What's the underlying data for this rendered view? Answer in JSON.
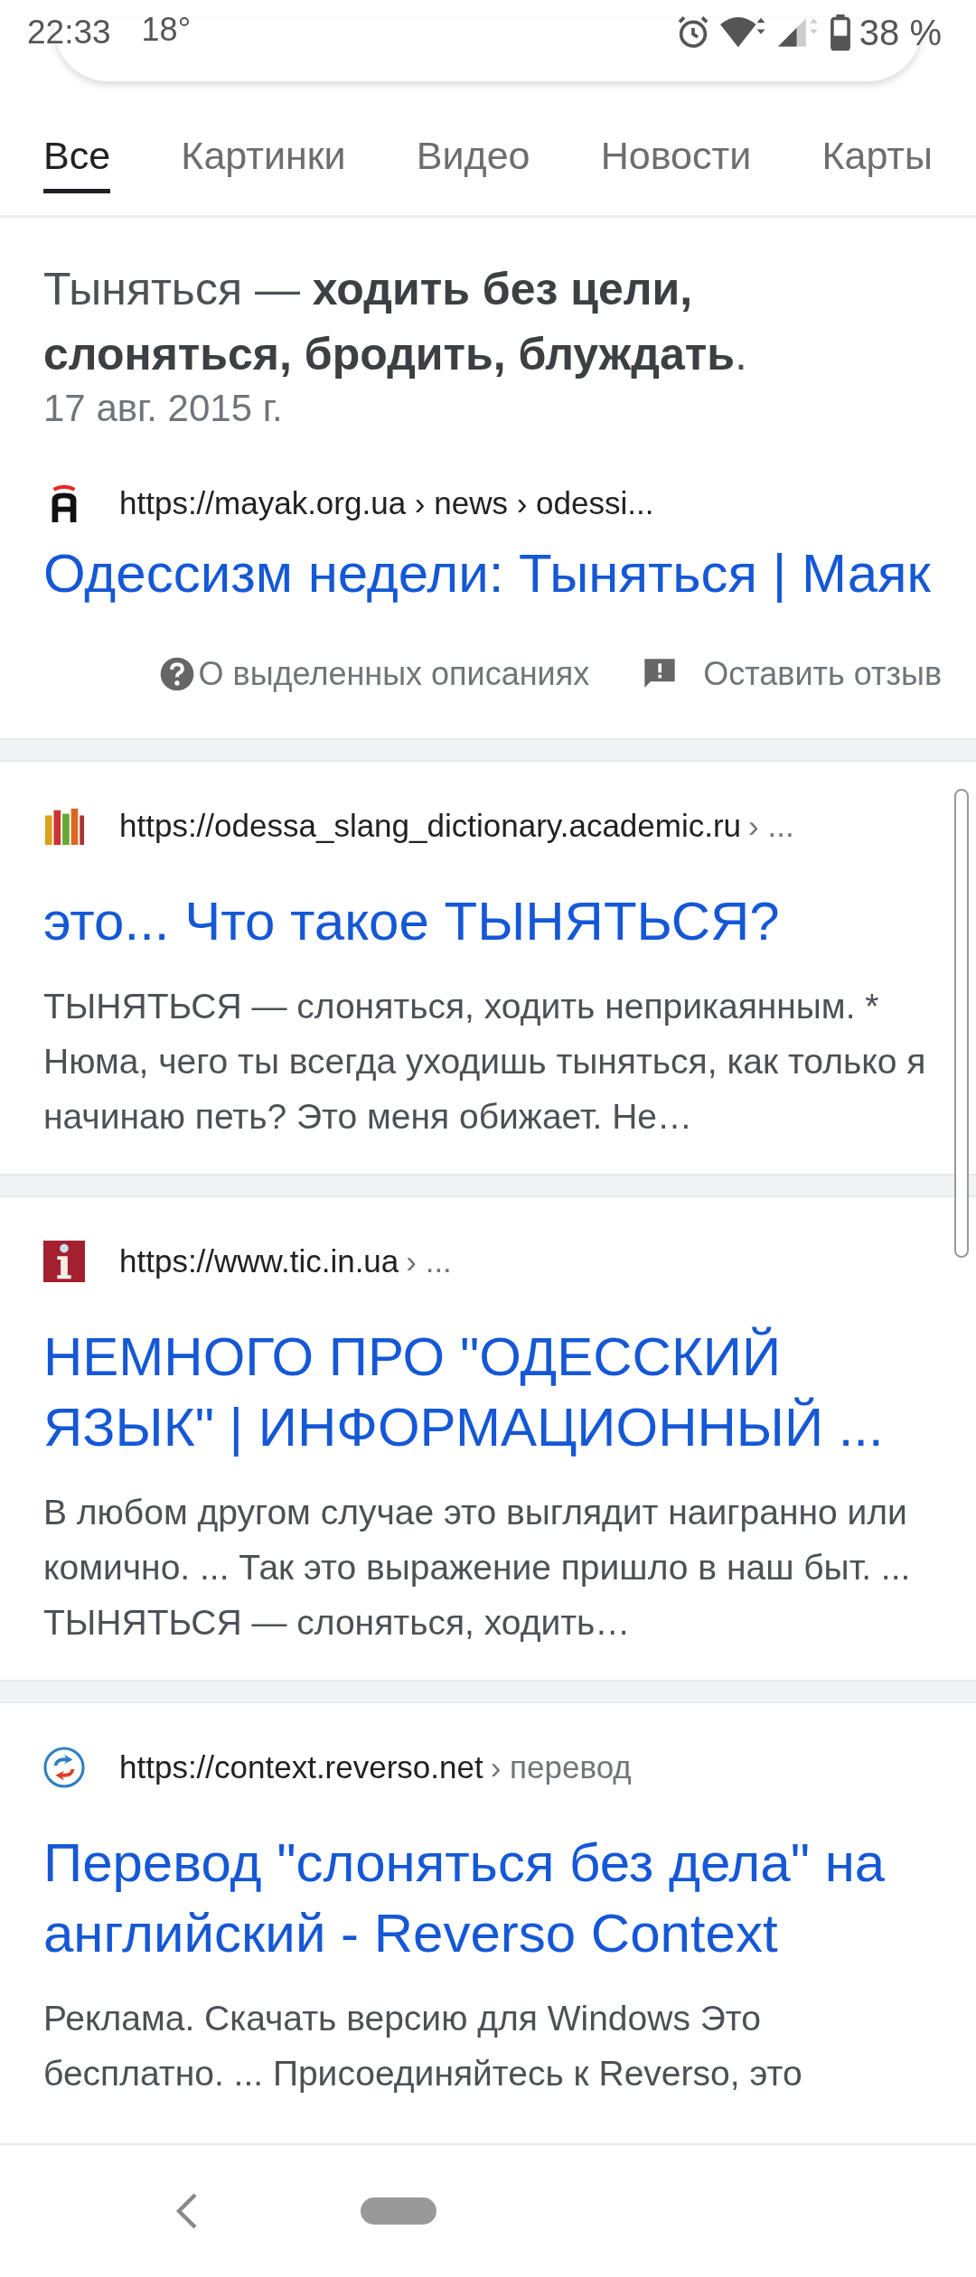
{
  "status_bar": {
    "time": "22:33",
    "temperature": "18°",
    "battery": "38 %"
  },
  "tabs": [
    {
      "label": "Все",
      "selected": true
    },
    {
      "label": "Картинки",
      "selected": false
    },
    {
      "label": "Видео",
      "selected": false
    },
    {
      "label": "Новости",
      "selected": false
    },
    {
      "label": "Карты",
      "selected": false
    }
  ],
  "featured_snippet": {
    "text": "Тыняться — **ходить без цели, слоняться, бродить, блуждать**.",
    "date": "17 авг. 2015 г.",
    "source": {
      "url": "https://mayak.org.ua › news › odessi...",
      "title": "Одессизм недели: Тыняться | Маяк"
    },
    "about": "О выделенных описаниях",
    "feedback": "Оставить отзыв"
  },
  "results": [
    {
      "kind": "books",
      "url": "https://odessa_slang_dictionary.academic.ru",
      "breadcrumb": "› ...",
      "title": "это... Что такое ТЫНЯТЬСЯ?",
      "snippet": "ТЫНЯТЬСЯ — слоняться, ходить неприкаянным. * Нюма, чего ты всегда уходишь тыняться, как только я начинаю петь? Это меня обижает. Не…"
    },
    {
      "kind": "info",
      "url": "https://www.tic.in.ua",
      "breadcrumb": "› ...",
      "title": "НЕМНОГО ПРО \"ОДЕССКИЙ ЯЗЫК\" | ИНФОРМАЦИОННЫЙ ...",
      "snippet": "В любом другом случае это выглядит наигранно или комично. ... Так это выражение пришло в наш быт. ... ТЫНЯТЬСЯ — слоняться, ходить…"
    },
    {
      "kind": "arrows",
      "url": "https://context.reverso.net",
      "breadcrumb": "› перевод",
      "title": "Перевод \"слоняться без дела\" на английский - Reverso Context",
      "snippet": "Реклама. Скачать версию для Windows Это бесплатно. ... Присоединяйтесь к Reverso, это"
    }
  ]
}
